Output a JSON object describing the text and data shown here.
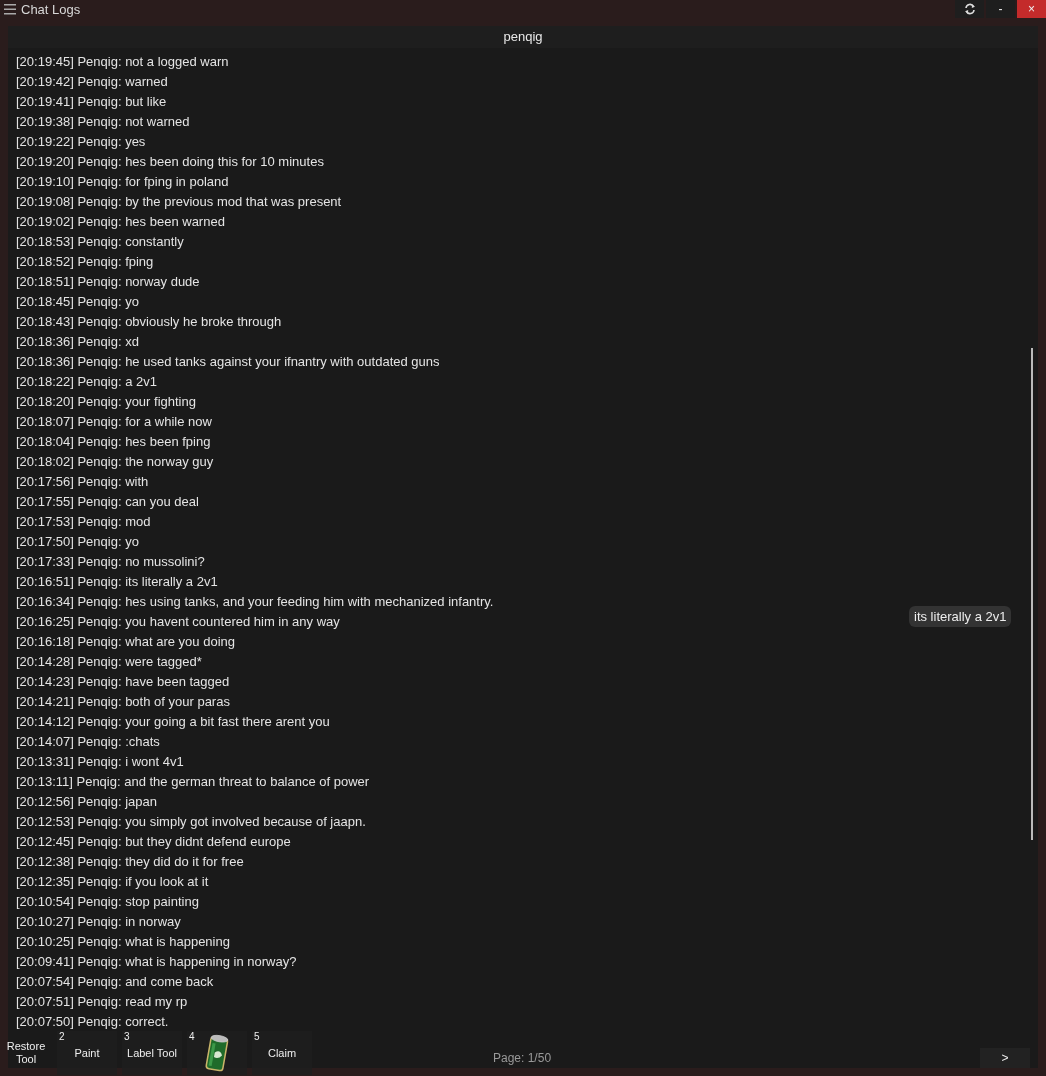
{
  "window": {
    "title": "Chat Logs"
  },
  "header": "penqig",
  "messages": [
    "[20:19:45] Penqig: not a logged warn",
    "[20:19:42] Penqig: warned",
    "[20:19:41] Penqig: but like",
    "[20:19:38] Penqig: not warned",
    "[20:19:22] Penqig: yes",
    "[20:19:20] Penqig: hes been doing this for 10 minutes",
    "[20:19:10] Penqig: for fping in poland",
    "[20:19:08] Penqig: by the previous mod that was present",
    "[20:19:02] Penqig: hes been warned",
    "[20:18:53] Penqig: constantly",
    "[20:18:52] Penqig: fping",
    "[20:18:51] Penqig: norway dude",
    "[20:18:45] Penqig: yo",
    "[20:18:43] Penqig: obviously he broke through",
    "[20:18:36] Penqig: xd",
    "[20:18:36] Penqig: he used tanks against your ifnantry with outdated guns",
    "[20:18:22] Penqig: a 2v1",
    "[20:18:20] Penqig: your fighting",
    "[20:18:07] Penqig: for a while now",
    "[20:18:04] Penqig: hes been fping",
    "[20:18:02] Penqig: the norway guy",
    "[20:17:56] Penqig: with",
    "[20:17:55] Penqig: can you deal",
    "[20:17:53] Penqig: mod",
    "[20:17:50] Penqig: yo",
    "[20:17:33] Penqig: no mussolini?",
    "[20:16:51] Penqig: its literally a 2v1",
    "[20:16:34] Penqig: hes using tanks, and your feeding him with mechanized infantry.",
    "[20:16:25] Penqig: you havent countered him in any way",
    "[20:16:18] Penqig: what are you doing",
    "[20:14:28] Penqig: were tagged*",
    "[20:14:23] Penqig: have been tagged",
    "[20:14:21] Penqig: both of your paras",
    "[20:14:12] Penqig: your going a bit fast there arent you",
    "[20:14:07] Penqig: :chats",
    "[20:13:31] Penqig: i wont 4v1",
    "[20:13:11] Penqig: and the german threat to balance of power",
    "[20:12:56] Penqig: japan",
    "[20:12:53] Penqig: you simply got involved because of jaapn.",
    "[20:12:45] Penqig: but they didnt defend europe",
    "[20:12:38] Penqig: they did do it for free",
    "[20:12:35] Penqig: if you look at it",
    "[20:10:54] Penqig: stop painting",
    "[20:10:27] Penqig: in norway",
    "[20:10:25] Penqig: what is happening",
    "[20:09:41] Penqig: what is happening in norway?",
    "[20:07:54] Penqig: and come back",
    "[20:07:51] Penqig: read my rp",
    "[20:07:50] Penqig: correct."
  ],
  "tooltip": "its literally a 2v1",
  "hotbar": [
    {
      "kind": "text",
      "label": "Restore Tool"
    },
    {
      "kind": "text",
      "number": "2",
      "label": "Paint"
    },
    {
      "kind": "text",
      "number": "3",
      "label": "Label Tool"
    },
    {
      "kind": "picture",
      "number": "4"
    },
    {
      "kind": "text",
      "number": "5",
      "label": "Claim"
    }
  ],
  "page": "Page: 1/50",
  "next_button": ">",
  "window_buttons": [
    {
      "kind": "refresh"
    },
    {
      "kind": "minimize",
      "label": "-"
    },
    {
      "kind": "close",
      "label": "×"
    }
  ]
}
